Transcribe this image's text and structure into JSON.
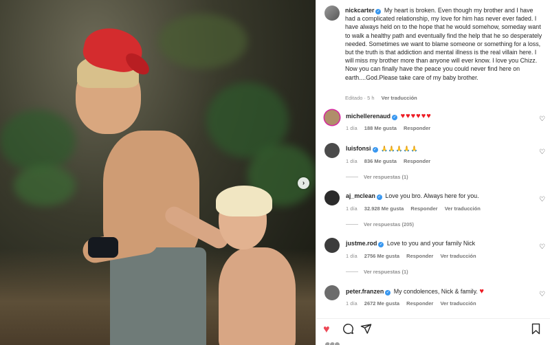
{
  "media": {
    "next_icon": "chevron-right-icon",
    "next_glyph": "›"
  },
  "caption": {
    "username": "nickcarter",
    "text": "My heart is broken. Even though my brother and I have had a complicated relationship, my love for him has never ever faded. I have always held on to the hope that he would somehow, someday want to walk a healthy path and eventually find the help that he so desperately needed. Sometimes we want to blame someone or something for a loss, but the truth is that addiction and mental illness is the real villain here. I will miss my brother more than anyone will ever know. I love you Chizz. Now you can finally have the peace you could never find here on earth....God.Please take care of my baby brother.",
    "edited": "Editado · 5 h",
    "translate": "Ver traducción"
  },
  "comments": [
    {
      "username": "michellerenaud",
      "text": "♥♥♥♥♥♥",
      "time": "1 día",
      "likes": "188 Me gusta",
      "reply": "Responder",
      "translate": "",
      "view_replies": ""
    },
    {
      "username": "luisfonsi",
      "text": "🙏🙏🙏🙏🙏",
      "time": "1 día",
      "likes": "836 Me gusta",
      "reply": "Responder",
      "translate": "",
      "view_replies": "Ver respuestas (1)"
    },
    {
      "username": "aj_mclean",
      "text": "Love you bro. Always here for you.",
      "time": "1 día",
      "likes": "32.928 Me gusta",
      "reply": "Responder",
      "translate": "Ver traducción",
      "view_replies": "Ver respuestas (205)"
    },
    {
      "username": "justme.rod",
      "text": "Love to you and your family Nick",
      "time": "1 día",
      "likes": "2756 Me gusta",
      "reply": "Responder",
      "translate": "Ver traducción",
      "view_replies": "Ver respuestas (1)"
    },
    {
      "username": "peter.franzen",
      "text": "My condolences, Nick & family.",
      "emoji": "♥",
      "time": "1 día",
      "likes": "2672 Me gusta",
      "reply": "Responder",
      "translate": "Ver traducción",
      "view_replies": ""
    }
  ],
  "actions": {
    "like_icon": "heart-filled-icon",
    "comment_icon": "comment-bubble-icon",
    "share_icon": "paper-plane-icon",
    "save_icon": "bookmark-icon",
    "like_color": "#ed4956"
  },
  "colors": {
    "verified": "#3897f0",
    "muted_text": "#8e8e8e",
    "heart_red": "#ed1c24"
  }
}
